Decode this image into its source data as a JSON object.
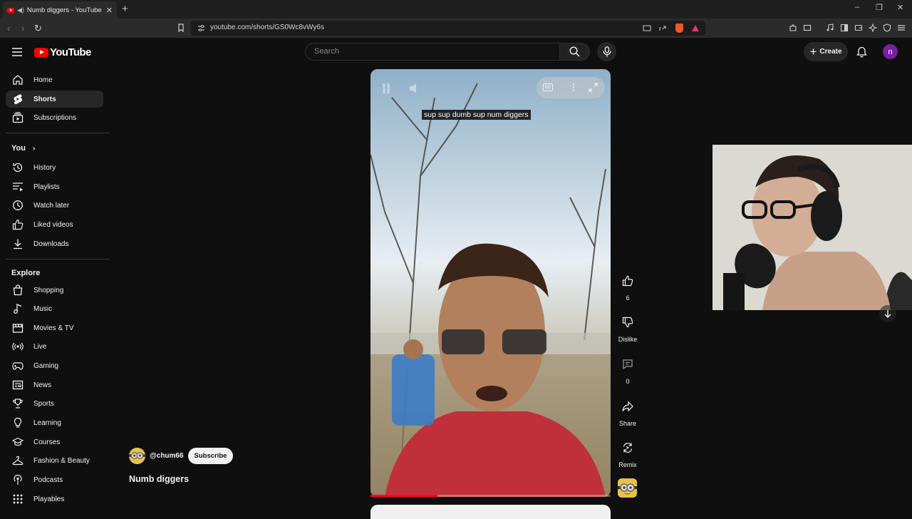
{
  "browser": {
    "tab_title": "Numb diggers - YouTube",
    "url": "youtube.com/shorts/GS0Wc8vWy6s"
  },
  "header": {
    "logo_text": "YouTube",
    "search_placeholder": "Search",
    "create_label": "Create",
    "avatar_letter": "n"
  },
  "sidebar": {
    "main": [
      {
        "label": "Home",
        "icon": "home-icon"
      },
      {
        "label": "Shorts",
        "icon": "shorts-icon",
        "active": true
      },
      {
        "label": "Subscriptions",
        "icon": "subscriptions-icon"
      }
    ],
    "you_heading": "You",
    "you_items": [
      {
        "label": "History",
        "icon": "history-icon"
      },
      {
        "label": "Playlists",
        "icon": "playlists-icon"
      },
      {
        "label": "Watch later",
        "icon": "clock-icon"
      },
      {
        "label": "Liked videos",
        "icon": "thumbs-up-icon"
      },
      {
        "label": "Downloads",
        "icon": "download-icon"
      }
    ],
    "explore_heading": "Explore",
    "explore_items": [
      {
        "label": "Shopping",
        "icon": "shopping-bag-icon"
      },
      {
        "label": "Music",
        "icon": "music-note-icon"
      },
      {
        "label": "Movies & TV",
        "icon": "clapperboard-icon"
      },
      {
        "label": "Live",
        "icon": "live-icon"
      },
      {
        "label": "Gaming",
        "icon": "gamepad-icon"
      },
      {
        "label": "News",
        "icon": "newspaper-icon"
      },
      {
        "label": "Sports",
        "icon": "trophy-icon"
      },
      {
        "label": "Learning",
        "icon": "lightbulb-icon"
      },
      {
        "label": "Courses",
        "icon": "graduation-cap-icon"
      },
      {
        "label": "Fashion & Beauty",
        "icon": "hanger-icon"
      },
      {
        "label": "Podcasts",
        "icon": "podcast-icon"
      },
      {
        "label": "Playables",
        "icon": "playables-icon"
      }
    ]
  },
  "video": {
    "caption": "sup sup dumb sup num diggers",
    "progress_fraction": 0.28,
    "cc_label": "CC"
  },
  "actions": {
    "like_count": "6",
    "dislike_label": "Dislike",
    "comment_count": "0",
    "share_label": "Share",
    "remix_label": "Remix"
  },
  "channel": {
    "handle": "@chum66",
    "subscribe_label": "Subscribe",
    "video_title": "Numb diggers"
  },
  "colors": {
    "brand_red": "#ff0000",
    "background": "#0f0f0f",
    "avatar_purple": "#7b1fa2"
  }
}
